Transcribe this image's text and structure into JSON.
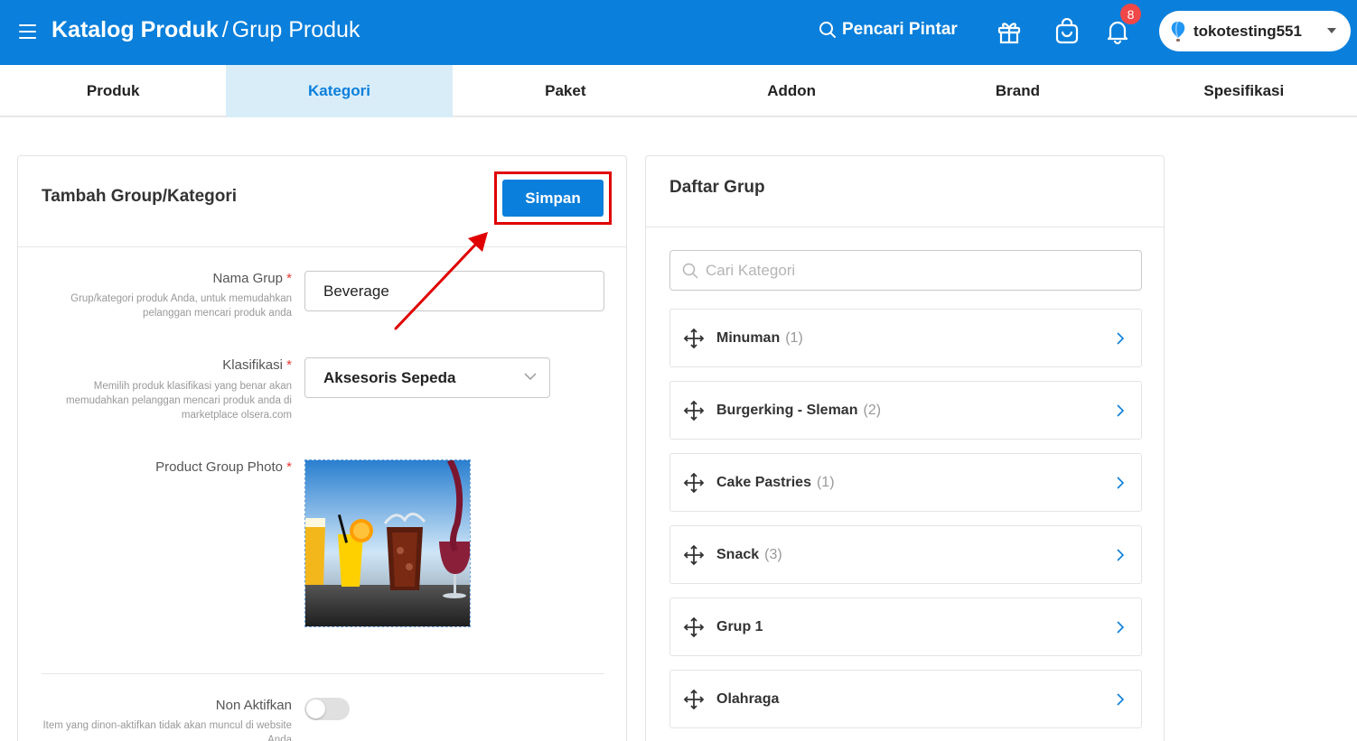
{
  "header": {
    "title_main": "Katalog Produk",
    "title_separator": "/",
    "title_sub": "Grup Produk",
    "smart_search_label": "Pencari Pintar",
    "notification_count": "8",
    "account_name": "tokotesting551",
    "icons": [
      "menu-icon",
      "search-icon",
      "gift-icon",
      "shopping-bag-icon",
      "bell-icon",
      "balloon-logo-icon",
      "caret-down-icon"
    ],
    "bg_color": "#0a7fdb"
  },
  "tabs": [
    {
      "label": "Produk",
      "active": false
    },
    {
      "label": "Kategori",
      "active": true
    },
    {
      "label": "Paket",
      "active": false
    },
    {
      "label": "Addon",
      "active": false
    },
    {
      "label": "Brand",
      "active": false
    },
    {
      "label": "Spesifikasi",
      "active": false
    }
  ],
  "form": {
    "title": "Tambah Group/Kategori",
    "save_label": "Simpan",
    "name_label": "Nama Grup",
    "name_hint": "Grup/kategori produk Anda, untuk memudahkan pelanggan mencari produk anda",
    "name_value": "Beverage",
    "classification_label": "Klasifikasi",
    "classification_hint": "Memilih produk klasifikasi yang benar akan memudahkan pelanggan mencari produk anda di marketplace olsera.com",
    "classification_value": "Aksesoris Sepeda",
    "photo_label": "Product Group Photo",
    "required_mark": "*",
    "deactivate_label": "Non Aktifkan",
    "deactivate_hint": "Item yang dinon-aktifkan tidak akan muncul di website Anda",
    "deactivate_on": false
  },
  "group_list": {
    "title": "Daftar Grup",
    "search_placeholder": "Cari Kategori",
    "items": [
      {
        "name": "Minuman",
        "count": "(1)"
      },
      {
        "name": "Burgerking - Sleman",
        "count": "(2)"
      },
      {
        "name": "Cake Pastries",
        "count": "(1)"
      },
      {
        "name": "Snack",
        "count": "(3)"
      },
      {
        "name": "Grup 1",
        "count": ""
      },
      {
        "name": "Olahraga",
        "count": ""
      }
    ]
  },
  "colors": {
    "accent": "#0a7fdb",
    "active_tab_bg": "#d9edf9",
    "highlight_red": "#e00000",
    "badge_red": "#f04747"
  }
}
